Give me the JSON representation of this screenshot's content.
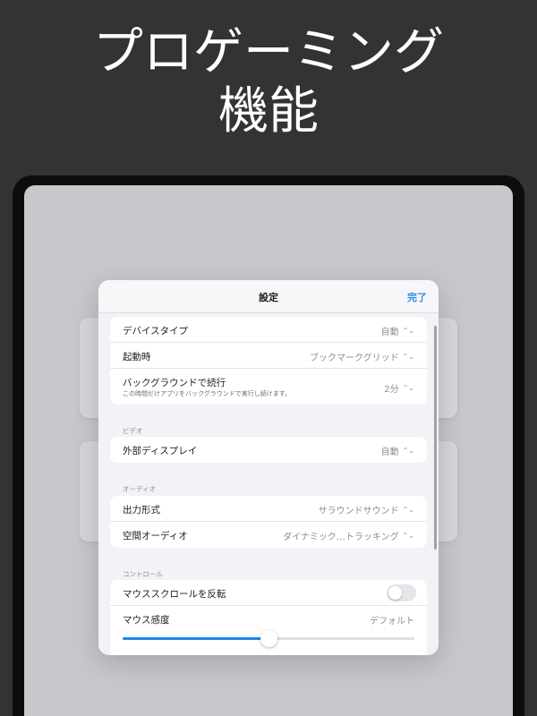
{
  "promo": {
    "line1": "プロゲーミング",
    "line2": "機能"
  },
  "sheet": {
    "title": "設定",
    "done_label": "完了"
  },
  "general": {
    "items": [
      {
        "label": "デバイスタイプ",
        "value": "自動"
      },
      {
        "label": "起動時",
        "value": "ブックマークグリッド"
      },
      {
        "label": "バックグラウンドで続行",
        "sublabel": "この時間だけアプリをバックグラウンドで実行し続けます。",
        "value": "2分"
      }
    ]
  },
  "video": {
    "header": "ビデオ",
    "items": [
      {
        "label": "外部ディスプレイ",
        "value": "自動"
      }
    ]
  },
  "audio": {
    "header": "オーディオ",
    "items": [
      {
        "label": "出力形式",
        "value": "サラウンドサウンド"
      },
      {
        "label": "空間オーディオ",
        "value": "ダイナミック…トラッキング"
      }
    ]
  },
  "controls": {
    "header": "コントロール",
    "invert_scroll": {
      "label": "マウススクロールを反転",
      "on": false
    },
    "mouse_sensitivity": {
      "label": "マウス感度",
      "value": "デフォルト",
      "level": 0.5
    }
  },
  "colors": {
    "accent": "#2c8de6",
    "slider": "#1e88e5",
    "background": "#333333"
  },
  "icons": {
    "chevron": "chevron-up-down-icon"
  }
}
